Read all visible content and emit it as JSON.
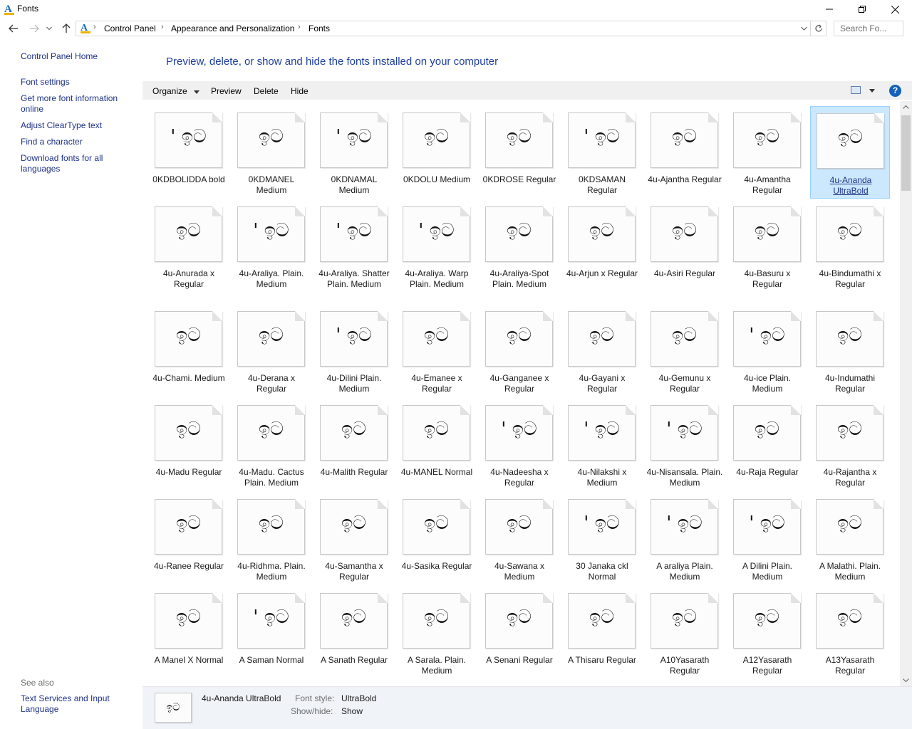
{
  "window": {
    "title": "Fonts",
    "app_icon": "A"
  },
  "address": {
    "icon": "A",
    "crumbs": [
      "Control Panel",
      "Appearance and Personalization",
      "Fonts"
    ],
    "search_placeholder": "Search Fo..."
  },
  "left_pane": {
    "home": "Control Panel Home",
    "links": [
      "Font settings",
      "Get more font information online",
      "Adjust ClearType text",
      "Find a character",
      "Download fonts for all languages"
    ],
    "see_also": "See also",
    "see_also_links": [
      "Text Services and Input Language"
    ]
  },
  "main": {
    "heading": "Preview, delete, or show and hide the fonts installed on your computer",
    "toolbar": {
      "organize": "Organize",
      "preview": "Preview",
      "delete": "Delete",
      "hide": "Hide",
      "help": "?"
    }
  },
  "fonts": [
    {
      "name": "0KDBOLIDDA bold",
      "preview": "' ඉට"
    },
    {
      "name": "0KDMANEL Medium",
      "preview": "ඉට"
    },
    {
      "name": "0KDNAMAL Medium",
      "preview": "' ඉට"
    },
    {
      "name": "0KDOLU Medium",
      "preview": "ඉට"
    },
    {
      "name": "0KDROSE Regular",
      "preview": "ඉට"
    },
    {
      "name": "0KDSAMAN Regular",
      "preview": "' ඉට"
    },
    {
      "name": "4u-Ajantha Regular",
      "preview": "ඉට"
    },
    {
      "name": "4u-Amantha Regular",
      "preview": "ඉට"
    },
    {
      "name": "4u-Ananda UltraBold",
      "preview": "ඉට"
    },
    {
      "name": "4u-Anurada x Regular",
      "preview": "ඉට"
    },
    {
      "name": "4u-Araliya. Plain. Medium",
      "preview": "' ඉට"
    },
    {
      "name": "4u-Araliya. Shatter Plain. Medium",
      "preview": "' ඉට"
    },
    {
      "name": "4u-Araliya. Warp Plain. Medium",
      "preview": "' ඉට"
    },
    {
      "name": "4u-Araliya-Spot Plain. Medium",
      "preview": "ඉට"
    },
    {
      "name": "4u-Arjun x Regular",
      "preview": "ඉට"
    },
    {
      "name": "4u-Asiri   Regular",
      "preview": "ඉට"
    },
    {
      "name": "4u-Basuru x Regular",
      "preview": "ඉට"
    },
    {
      "name": "4u-Bindumathi x Regular",
      "preview": "ඉට"
    },
    {
      "name": "4u-Chami. Medium",
      "preview": "ඉට"
    },
    {
      "name": "4u-Derana x Regular",
      "preview": "ඉට"
    },
    {
      "name": "4u-Dilini     Plain. Medium",
      "preview": "' ඉට"
    },
    {
      "name": "4u-Emanee x Regular",
      "preview": "ඉට"
    },
    {
      "name": "4u-Ganganee x Regular",
      "preview": "ඉට"
    },
    {
      "name": "4u-Gayani x Regular",
      "preview": "ඉට"
    },
    {
      "name": "4u-Gemunu x Regular",
      "preview": "ඉට"
    },
    {
      "name": "4u-ice Plain. Medium",
      "preview": "' ඉට"
    },
    {
      "name": "4u-Indumathi Regular",
      "preview": "ඉට"
    },
    {
      "name": "4u-Madu Regular",
      "preview": "ඉට"
    },
    {
      "name": "4u-Madu. Cactus Plain. Medium",
      "preview": "ඉට"
    },
    {
      "name": "4u-Malith Regular",
      "preview": "ඉට"
    },
    {
      "name": "4u-MANEL Normal",
      "preview": "ඉට"
    },
    {
      "name": "4u-Nadeesha x Regular",
      "preview": "' ඉට"
    },
    {
      "name": "4u-Nilakshi x Medium",
      "preview": "' ඉට"
    },
    {
      "name": "4u-Nisansala. Plain. Medium",
      "preview": "' ඉට"
    },
    {
      "name": "4u-Raja    Regular",
      "preview": "ඉට"
    },
    {
      "name": "4u-Rajantha x Regular",
      "preview": "ඉට"
    },
    {
      "name": "4u-Ranee Regular",
      "preview": "ඉට"
    },
    {
      "name": "4u-Ridhma. Plain. Medium",
      "preview": "ඉට"
    },
    {
      "name": "4u-Samantha x Regular",
      "preview": "ඉට"
    },
    {
      "name": "4u-Sasika Regular",
      "preview": "ඉට"
    },
    {
      "name": "4u-Sawana x Medium",
      "preview": "ඉට"
    },
    {
      "name": "30 Janaka ckl Normal",
      "preview": "' ඉට"
    },
    {
      "name": "A araliya Plain. Medium",
      "preview": "' ඉට"
    },
    {
      "name": "A Dilini Plain. Medium",
      "preview": "' ඉට"
    },
    {
      "name": "A Malathi. Plain. Medium",
      "preview": "ඉට"
    },
    {
      "name": "A Manel X Normal",
      "preview": "ඉට"
    },
    {
      "name": "A Saman Normal",
      "preview": "' ඉට"
    },
    {
      "name": "A Sanath Regular",
      "preview": "ඉට"
    },
    {
      "name": "A Sarala. Plain. Medium",
      "preview": "ඉට"
    },
    {
      "name": "A Senani Regular",
      "preview": "ඉට"
    },
    {
      "name": "A Thisaru Regular",
      "preview": "ඉට"
    },
    {
      "name": "A10Yasarath Regular",
      "preview": "ඉට"
    },
    {
      "name": "A12Yasarath Regular",
      "preview": "ඉට"
    },
    {
      "name": "A13Yasarath Regular",
      "preview": "ඉට"
    }
  ],
  "selected_index": 8,
  "details": {
    "thumb": "ඉට",
    "name": "4u-Ananda UltraBold",
    "font_style_label": "Font style:",
    "font_style": "UltraBold",
    "show_hide_label": "Show/hide:",
    "show_hide": "Show"
  },
  "colors": {
    "link": "#1e3287",
    "heading": "#1e3fa0",
    "selection": "#cce8ff",
    "help_icon": "#1560bd"
  }
}
